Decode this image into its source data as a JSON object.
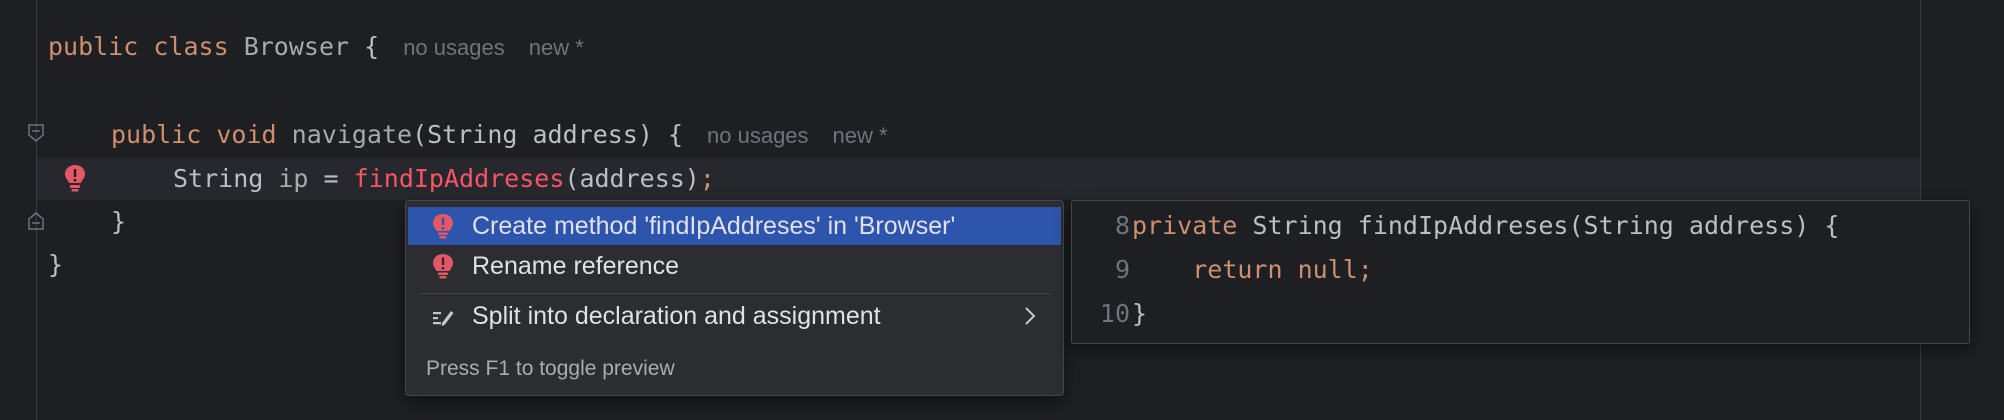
{
  "editor": {
    "line1": {
      "kw1": "public",
      "kw2": "class",
      "name": "Browser",
      "brace": "{",
      "hint_usages": "no usages",
      "hint_new": "new *"
    },
    "line3": {
      "kw1": "public",
      "kw2": "void",
      "name": "navigate",
      "sig": "(String address) {",
      "hint_usages": "no usages",
      "hint_new": "new *"
    },
    "line4": {
      "type": "String",
      "var": "ip",
      "eq": "=",
      "call": "findIpAddreses",
      "args": "(address)",
      "semi": ";"
    },
    "line5": {
      "text": "}"
    },
    "line6": {
      "text": "}"
    }
  },
  "popup": {
    "items": [
      {
        "label": "Create method 'findIpAddreses' in 'Browser'",
        "icon": "error-bulb-icon"
      },
      {
        "label": "Rename reference",
        "icon": "error-bulb-icon"
      },
      {
        "label": "Split into declaration and assignment",
        "icon": "edit-intention-icon"
      }
    ],
    "footer": "Press F1 to toggle preview"
  },
  "preview": {
    "lines": [
      {
        "num": "8",
        "kw": "private",
        "rest": " String findIpAddreses(String address) {"
      },
      {
        "num": "9",
        "kw": "return null;",
        "indent": "    "
      },
      {
        "num": "10",
        "text": "}"
      }
    ]
  },
  "colors": {
    "keyword": "#cf8e6d",
    "error": "#f75464",
    "selection": "#2e55ad",
    "background": "#1e1f22"
  }
}
